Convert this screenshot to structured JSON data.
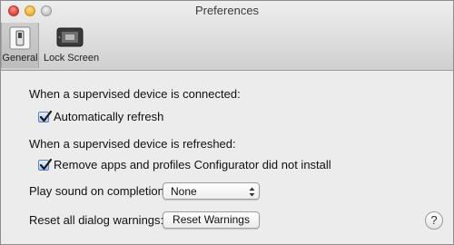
{
  "window": {
    "title": "Preferences"
  },
  "toolbar": {
    "items": [
      {
        "label": "General",
        "icon": "switch-icon",
        "selected": true
      },
      {
        "label": "Lock Screen",
        "icon": "lock-screen-icon",
        "selected": false
      }
    ]
  },
  "connected": {
    "heading": "When a supervised device is connected:",
    "checkbox_label": "Automatically refresh",
    "checked": true
  },
  "refreshed": {
    "heading": "When a supervised device is refreshed:",
    "checkbox_label": "Remove apps and profiles Configurator did not install",
    "checked": true
  },
  "sound": {
    "label": "Play sound on completion:",
    "selected": "None"
  },
  "warnings": {
    "label": "Reset all dialog warnings:",
    "button_label": "Reset Warnings"
  },
  "help": {
    "glyph": "?"
  },
  "colors": {
    "checkbox_accent": "#4a7bd0"
  }
}
